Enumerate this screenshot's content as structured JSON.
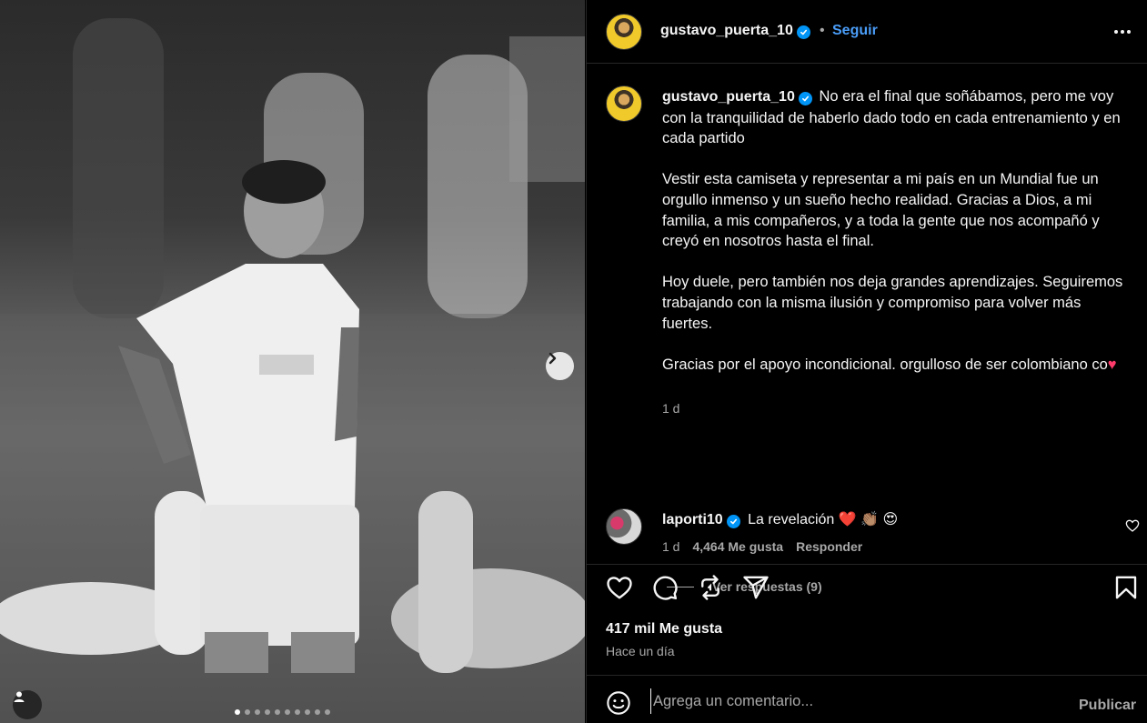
{
  "post": {
    "author": "gustavo_puerta_10",
    "follow_label": "Seguir",
    "separator": "•",
    "caption_paragraphs": [
      "No era el final que soñábamos, pero me voy con la tranquilidad de haberlo dado todo en cada entrenamiento y en cada partido",
      "Vestir esta camiseta y representar a mi país en un Mundial fue un orgullo inmenso y un sueño hecho realidad. Gracias a Dios, a mi familia, a mis compañeros, y a toda la gente que nos acompañó y creyó en nosotros hasta el final.",
      "Hoy duele, pero también nos deja grandes aprendizajes. Seguiremos trabajando con la misma ilusión y compromiso para volver más fuertes."
    ],
    "caption_last": "Gracias por el apoyo incondicional. orgulloso de ser colombiano co",
    "caption_last_emoji": "♥",
    "caption_time": "1 d",
    "likes": "417 mil Me gusta",
    "posted": "Hace un día"
  },
  "comment": {
    "author": "laporti10",
    "text": "La revelación",
    "emojis": "❤️ 👏🏽 😍",
    "time": "1 d",
    "likes": "4,464 Me gusta",
    "reply_label": "Responder",
    "view_replies": "Ver respuestas (9)"
  },
  "composer": {
    "placeholder": "Agrega un comentario...",
    "publish_label": "Publicar"
  },
  "carousel": {
    "total": 10,
    "active_index": 0
  },
  "icons": {
    "header_more": "more-horizontal-icon",
    "verified": "verified-badge-icon",
    "like": "heart-icon",
    "comment": "comment-icon",
    "repost": "repost-icon",
    "share": "share-icon",
    "save": "bookmark-icon",
    "emoji": "emoji-icon",
    "next": "chevron-right-icon",
    "tagged": "user-tag-icon"
  },
  "colors": {
    "link": "#4a9df8",
    "verified": "#0095f6",
    "secondary_text": "#a8a8a8",
    "heart": "#ff3b6b"
  }
}
